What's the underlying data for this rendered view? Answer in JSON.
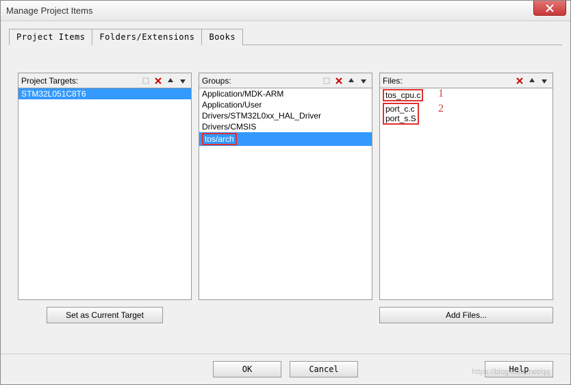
{
  "window": {
    "title": "Manage Project Items"
  },
  "tabs": [
    {
      "label": "Project Items",
      "active": true
    },
    {
      "label": "Folders/Extensions",
      "active": false
    },
    {
      "label": "Books",
      "active": false
    }
  ],
  "panels": {
    "targets": {
      "title": "Project Targets:",
      "items": [
        "STM32L051C8T6"
      ],
      "selectedIndex": 0,
      "button": "Set as Current Target"
    },
    "groups": {
      "title": "Groups:",
      "items": [
        "Application/MDK-ARM",
        "Application/User",
        "Drivers/STM32L0xx_HAL_Driver",
        "Drivers/CMSIS",
        "tos/arch"
      ],
      "selectedIndex": 4
    },
    "files": {
      "title": "Files:",
      "items": [
        "tos_cpu.c",
        "port_c.c",
        "port_s.S"
      ],
      "button": "Add Files..."
    }
  },
  "annotations": {
    "a1": "1",
    "a2": "2"
  },
  "buttons": {
    "ok": "OK",
    "cancel": "Cancel",
    "help": "Help"
  },
  "watermark": "https://blog.csdn.net/qq"
}
